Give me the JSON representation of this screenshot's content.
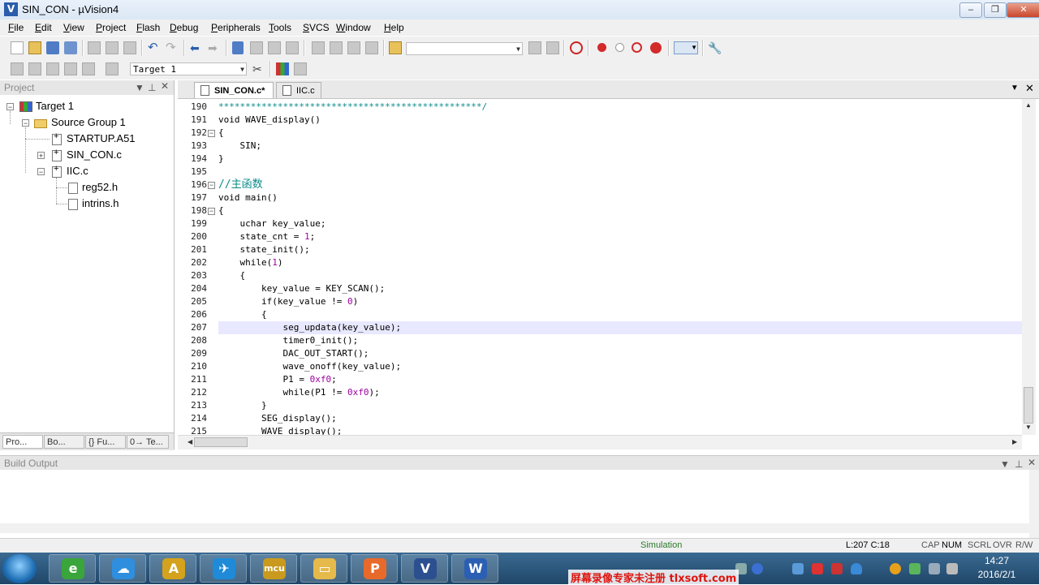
{
  "window": {
    "title": "SIN_CON - µVision4",
    "minimize": "‒",
    "restore": "❐",
    "close": "✕"
  },
  "menu": [
    {
      "label": "File",
      "u": "F",
      "rest": "ile"
    },
    {
      "label": "Edit",
      "u": "E",
      "rest": "dit"
    },
    {
      "label": "View",
      "u": "V",
      "rest": "iew"
    },
    {
      "label": "Project",
      "u": "P",
      "rest": "roject"
    },
    {
      "label": "Flash",
      "u": "F",
      "rest": "lash"
    },
    {
      "label": "Debug",
      "u": "D",
      "rest": "ebug"
    },
    {
      "label": "Peripherals",
      "u": "P",
      "rest": "eripherals"
    },
    {
      "label": "Tools",
      "u": "T",
      "rest": "ools"
    },
    {
      "label": "SVCS",
      "u": "S",
      "rest": "VCS"
    },
    {
      "label": "Window",
      "u": "W",
      "rest": "indow"
    },
    {
      "label": "Help",
      "u": "H",
      "rest": "elp"
    }
  ],
  "toolbar": {
    "find_combo_value": "",
    "target_combo_value": "Target 1"
  },
  "project": {
    "header": "Project",
    "tree": {
      "target": "Target 1",
      "group": "Source Group 1",
      "files": [
        "STARTUP.A51",
        "SIN_CON.c",
        "IIC.c"
      ],
      "headers": [
        "reg52.h",
        "intrins.h"
      ]
    },
    "tabs": [
      "Pro...",
      "Bo...",
      "{} Fu...",
      "0→ Te..."
    ]
  },
  "editor": {
    "tabs": [
      {
        "label": "SIN_CON.c*",
        "active": true
      },
      {
        "label": "IIC.c",
        "active": false
      }
    ],
    "first_line": 190,
    "current_line": 207,
    "lines": [
      {
        "n": 190,
        "text": "*************************************************/",
        "fold": false
      },
      {
        "n": 191,
        "text": "void WAVE_display()",
        "fold": false
      },
      {
        "n": 192,
        "text": "{",
        "fold": true
      },
      {
        "n": 193,
        "text": "    SIN;",
        "fold": false
      },
      {
        "n": 194,
        "text": "}",
        "fold": false
      },
      {
        "n": 195,
        "text": "",
        "fold": false
      },
      {
        "n": 196,
        "text": "//主函数",
        "fold": true
      },
      {
        "n": 197,
        "text": "void main()",
        "fold": false
      },
      {
        "n": 198,
        "text": "{",
        "fold": true
      },
      {
        "n": 199,
        "text": "    uchar key_value;",
        "fold": false
      },
      {
        "n": 200,
        "text": "    state_cnt = 1;",
        "fold": false
      },
      {
        "n": 201,
        "text": "    state_init();",
        "fold": false
      },
      {
        "n": 202,
        "text": "    while(1)",
        "fold": false
      },
      {
        "n": 203,
        "text": "    {",
        "fold": false
      },
      {
        "n": 204,
        "text": "        key_value = KEY_SCAN();",
        "fold": false
      },
      {
        "n": 205,
        "text": "        if(key_value != 0)",
        "fold": false
      },
      {
        "n": 206,
        "text": "        {",
        "fold": false
      },
      {
        "n": 207,
        "text": "            seg_updata(key_value);",
        "fold": false
      },
      {
        "n": 208,
        "text": "            timer0_init();",
        "fold": false
      },
      {
        "n": 209,
        "text": "            DAC_OUT_START();",
        "fold": false
      },
      {
        "n": 210,
        "text": "            wave_onoff(key_value);",
        "fold": false
      },
      {
        "n": 211,
        "text": "            P1 = 0xf0;",
        "fold": false
      },
      {
        "n": 212,
        "text": "            while(P1 != 0xf0);",
        "fold": false
      },
      {
        "n": 213,
        "text": "        }",
        "fold": false
      },
      {
        "n": 214,
        "text": "        SEG_display();",
        "fold": false
      },
      {
        "n": 215,
        "text": "        WAVE_display();",
        "fold": false
      }
    ]
  },
  "build_output": {
    "header": "Build Output"
  },
  "status": {
    "mode": "Simulation",
    "position": "L:207 C:18",
    "indicators": [
      {
        "label": "CAP",
        "on": false
      },
      {
        "label": "NUM",
        "on": true
      },
      {
        "label": "SCRL",
        "on": false
      },
      {
        "label": "OVR",
        "on": false
      },
      {
        "label": "R/W",
        "on": false
      }
    ]
  },
  "taskbar": {
    "apps": [
      {
        "name": "360-browser",
        "glyph": "e",
        "color": "#3aa53a"
      },
      {
        "name": "baidu-netdisk",
        "glyph": "☁",
        "color": "#2f8fde"
      },
      {
        "name": "font-app",
        "glyph": "A",
        "color": "#d4a21c"
      },
      {
        "name": "feiq",
        "glyph": "✈",
        "color": "#1e8ad8"
      },
      {
        "name": "qihang-mcu",
        "glyph": "mcu",
        "color": "#c99a1e"
      },
      {
        "name": "explorer",
        "glyph": "▭",
        "color": "#e5b94a"
      },
      {
        "name": "ppt",
        "glyph": "P",
        "color": "#e86a2a"
      },
      {
        "name": "keil-uvision4",
        "glyph": "V",
        "color": "#2c4f8f"
      },
      {
        "name": "word",
        "glyph": "W",
        "color": "#2b5fb3"
      }
    ],
    "watermark": "屏幕录像专家未注册 tlxsoft.com",
    "time": "14:27",
    "date": "2016/2/1"
  },
  "colors": {
    "accent": "#2a5dab",
    "highlight_line": "#e8e8ff",
    "comment": "#0b8b8b",
    "number": "#a000a0"
  }
}
